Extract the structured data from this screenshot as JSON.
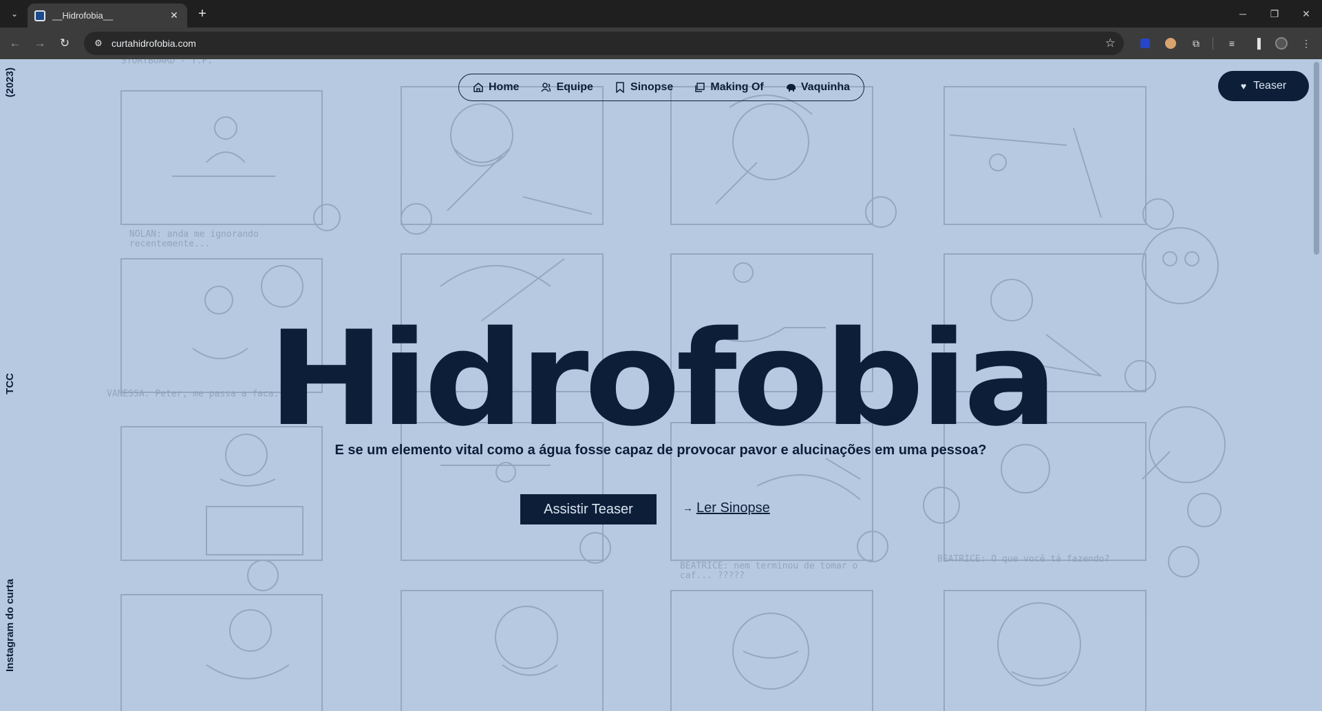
{
  "browser": {
    "tab_title": "__Hidrofobia__",
    "url": "curtahidrofobia.com",
    "tab_search_icon": "chevron-down-icon",
    "window_controls": [
      "minimize",
      "restore",
      "close"
    ]
  },
  "side": {
    "year": "(2023)",
    "tcc": "TCC",
    "instagram": "Instagram do curta"
  },
  "nav": {
    "items": [
      {
        "label": "Home",
        "icon": "home-icon"
      },
      {
        "label": "Equipe",
        "icon": "people-icon"
      },
      {
        "label": "Sinopse",
        "icon": "bookmark-icon"
      },
      {
        "label": "Making Of",
        "icon": "gallery-icon"
      },
      {
        "label": "Vaquinha",
        "icon": "piggy-bank-icon"
      }
    ]
  },
  "teaser_button": "Teaser",
  "hero": {
    "title": "Hidrofobia",
    "tagline": "E se um elemento vital como a água fosse capaz de provocar pavor e alucinações em uma pessoa?",
    "primary_cta": "Assistir Teaser",
    "secondary_cta": " Ler Sinopse"
  },
  "colors": {
    "page_bg": "#b7c9e1",
    "navy": "#0d1f38",
    "sketch": "#8a9cb4"
  }
}
